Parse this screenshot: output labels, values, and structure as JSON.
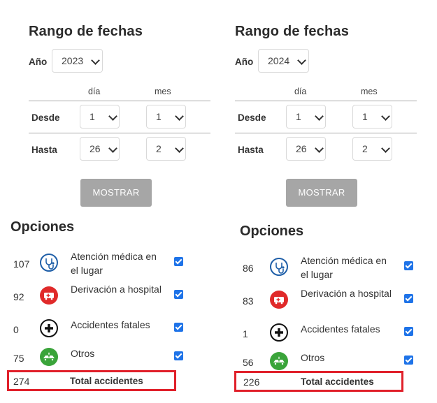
{
  "panels": [
    {
      "date_range": {
        "title": "Rango de fechas",
        "year_label": "Año",
        "year_value": "2023",
        "day_header": "día",
        "month_header": "mes",
        "from_label": "Desde",
        "from_day": "1",
        "from_month": "1",
        "to_label": "Hasta",
        "to_day": "26",
        "to_month": "2",
        "show_button": "MOSTRAR"
      },
      "options": {
        "title": "Opciones",
        "items": [
          {
            "count": "107",
            "label": "Atención médica en el lugar",
            "icon": "stethoscope-icon",
            "checked": true
          },
          {
            "count": "92",
            "label": "Derivación a hospital",
            "icon": "ambulance-icon",
            "checked": true
          },
          {
            "count": "0",
            "label": "Accidentes fatales",
            "icon": "plus-cross-icon",
            "checked": true
          },
          {
            "count": "75",
            "label": "Otros",
            "icon": "car-crash-icon",
            "checked": true
          }
        ],
        "total_count": "274",
        "total_label": "Total accidentes"
      }
    },
    {
      "date_range": {
        "title": "Rango de fechas",
        "year_label": "Año",
        "year_value": "2024",
        "day_header": "día",
        "month_header": "mes",
        "from_label": "Desde",
        "from_day": "1",
        "from_month": "1",
        "to_label": "Hasta",
        "to_day": "26",
        "to_month": "2",
        "show_button": "MOSTRAR"
      },
      "options": {
        "title": "Opciones",
        "items": [
          {
            "count": "86",
            "label": "Atención médica en el lugar",
            "icon": "stethoscope-icon",
            "checked": true
          },
          {
            "count": "83",
            "label": "Derivación a hospital",
            "icon": "ambulance-icon",
            "checked": true
          },
          {
            "count": "1",
            "label": "Accidentes fatales",
            "icon": "plus-cross-icon",
            "checked": true
          },
          {
            "count": "56",
            "label": "Otros",
            "icon": "car-crash-icon",
            "checked": true
          }
        ],
        "total_count": "226",
        "total_label": "Total accidentes"
      }
    }
  ],
  "colors": {
    "checkbox": "#1e73e8",
    "highlight": "#e0202a",
    "button": "#a6a6a6",
    "stethoscope": "#1f5fa8",
    "ambulance": "#e02a2a",
    "fatal": "#111111",
    "others": "#3aa43a"
  }
}
